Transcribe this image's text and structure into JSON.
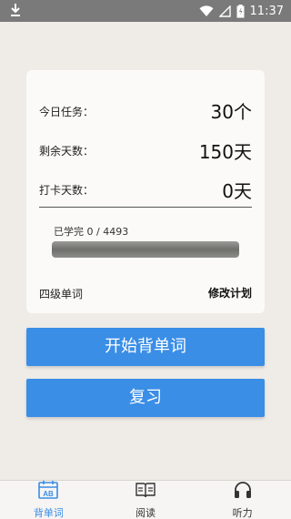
{
  "status": {
    "time": "11:37"
  },
  "plan": {
    "task_label": "今日任务：",
    "task_value": "30个",
    "remaining_label": "剩余天数：",
    "remaining_value": "150天",
    "checkin_label": "打卡天数：",
    "checkin_value": "0天",
    "learned_text": "已学完 0 / 4493",
    "progress_fraction": 0,
    "book": "四级单词",
    "modify_label": "修改计划"
  },
  "actions": {
    "start_label": "开始背单词",
    "review_label": "复习"
  },
  "tabs": [
    {
      "label": "背单词",
      "icon": "calendar-ab-icon",
      "active": true
    },
    {
      "label": "阅读",
      "icon": "book-icon",
      "active": false
    },
    {
      "label": "听力",
      "icon": "headphones-icon",
      "active": false
    }
  ],
  "colors": {
    "accent": "#3a8ee6",
    "background": "#efebe7",
    "statusbar": "#7a7a7a"
  }
}
